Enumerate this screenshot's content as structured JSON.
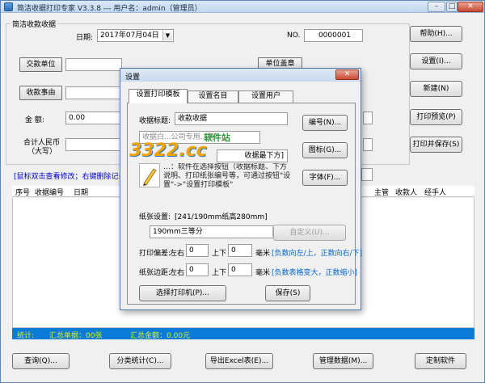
{
  "window": {
    "title": "简洁收据打印专家 V3.3.8 --- 用户名：admin（管理员）",
    "min_label": "–",
    "max_label": "□",
    "close_label": "✕"
  },
  "receipt": {
    "group_title": "简洁收款收据",
    "date_label": "日期:",
    "date_value": "2017年07月04日",
    "no_label": "NO.",
    "no_value": "0000001",
    "payer_button": "交款单位",
    "payer_value": "",
    "reason_button": "收款事由",
    "reason_value": "",
    "amount_label": "金  额:",
    "amount_value": "0.00",
    "rmb_label_line1": "合计人民币",
    "rmb_label_line2": "（大写）",
    "unit_button": "单位盖章",
    "hint": "[鼠标双击查看修改；右键删除记录",
    "dropdown_arrow": "▼"
  },
  "side_buttons": {
    "help": "帮助(H)...",
    "settings": "设置(I)...",
    "new": "新建(N)",
    "print_preview": "打印预览(P)",
    "print_save": "打印并保存(S)"
  },
  "table": {
    "columns": [
      "序号",
      "收据编号",
      "日期",
      "主管",
      "收款人",
      "经手人"
    ]
  },
  "status": {
    "stats_label": "统计:",
    "total_count": "汇总单据：00张",
    "total_amount": "汇总金额：0.00元"
  },
  "bottom_buttons": {
    "query": "查询(Q)...",
    "classify": "分类统计(C)...",
    "export_excel": "导出Excel表(E)...",
    "manage_data": "管理数据(M)...",
    "customize": "定制软件"
  },
  "dialog": {
    "title": "设置",
    "tabs": [
      "设置打印模板",
      "设置名目",
      "设置用户"
    ],
    "receipt_title_label": "收据标题:",
    "receipt_title_value": "收款收据",
    "number_button": "编号(N)...",
    "icon_button": "图标(G)...",
    "font_button": "字体(F)...",
    "copy_partial": "收据白...公司专用...黄",
    "bottom_partial": "收据最下方]",
    "template_note": "…：软件在选择按钮（收据标题、下方说明、打印纸张编号等，可通过按钮\"设置\"->\"设置打印模板\"",
    "paper_settings_label": "纸张设置:",
    "paper_settings_value": "[241/190mm纸高280mm]",
    "paper_select_value": "190mm三等分",
    "custom_button": "自定义(U)...",
    "print_offset_label": "打印偏差:",
    "margin_label": "纸张边距:",
    "left_right_label": "左右",
    "up_down_label": "上下",
    "unit_mm": "毫米",
    "offset_lr_value": "0",
    "offset_ud_value": "0",
    "margin_lr_value": "0",
    "margin_ud_value": "0",
    "offset_hint": "[负数向左/上，正数向右/下]",
    "margin_hint": "[负数表格变大，正数缩小]",
    "select_printer_button": "选择打印机(P)...",
    "save_button": "保存(S)",
    "close_label": "✕"
  },
  "watermark": {
    "logo_text": "3322.cc",
    "subtitle": "软件站"
  },
  "colors": {
    "status_bg": "#0b7bd7",
    "status_text": "#d9ef32",
    "hint_text": "#0000cc",
    "dialog_hint": "#0055cc"
  }
}
